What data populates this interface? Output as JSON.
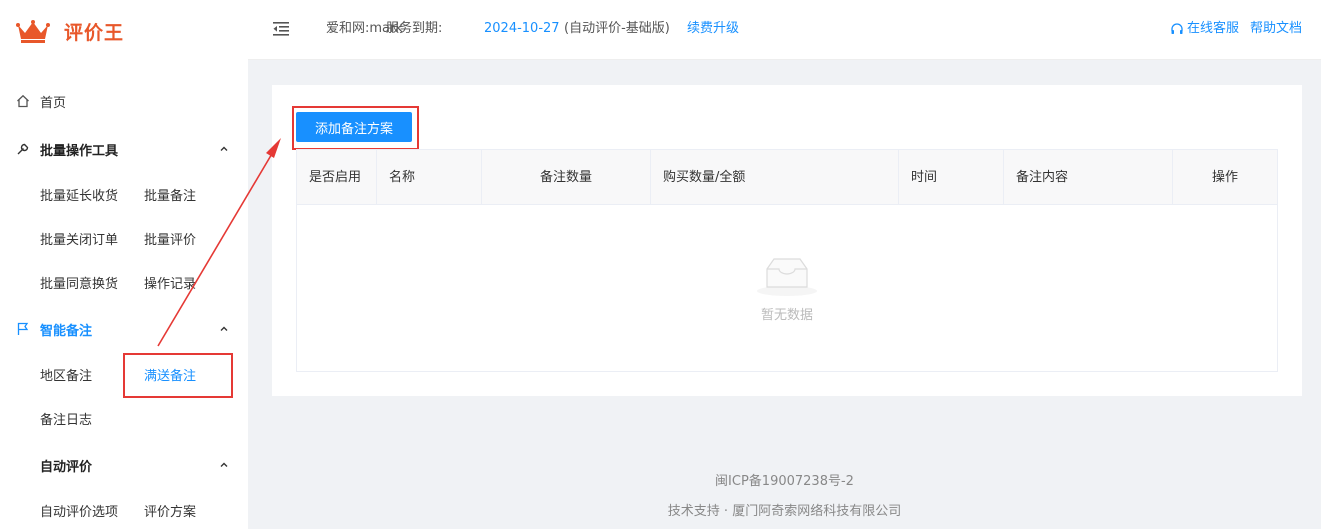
{
  "brand": {
    "name": "评价王",
    "color": "#e8572a"
  },
  "colors": {
    "accent": "#1890ff",
    "annotation": "#e53935"
  },
  "sidebar": {
    "home": {
      "label": "首页",
      "icon": "home-icon"
    },
    "groups": [
      {
        "label": "批量操作工具",
        "icon": "wrench-icon",
        "items": [
          "批量延长收货",
          "批量备注",
          "批量关闭订单",
          "批量评价",
          "批量同意换货",
          "操作记录"
        ]
      },
      {
        "label": "智能备注",
        "icon": "flag-icon",
        "active": true,
        "items": [
          "地区备注",
          "满送备注",
          "备注日志"
        ],
        "active_item": "满送备注"
      },
      {
        "label": "自动评价",
        "items": [
          "自动评价选项",
          "评价方案"
        ]
      }
    ]
  },
  "header": {
    "user": "爱和网:mark",
    "expiry_label": "服务到期:",
    "expiry_date": "2024-10-27",
    "plan": "(自动评价-基础版)",
    "renew": "续费升级",
    "service": "在线客服",
    "docs": "帮助文档"
  },
  "main": {
    "add_button": "添加备注方案",
    "table": {
      "columns": [
        "是否启用",
        "名称",
        "备注数量",
        "购买数量/全额",
        "时间",
        "备注内容",
        "操作"
      ],
      "rows": [],
      "empty_text": "暂无数据"
    }
  },
  "footer": {
    "icp": "闽ICP备19007238号-2",
    "support": "技术支持 · 厦门阿奇索网络科技有限公司"
  }
}
